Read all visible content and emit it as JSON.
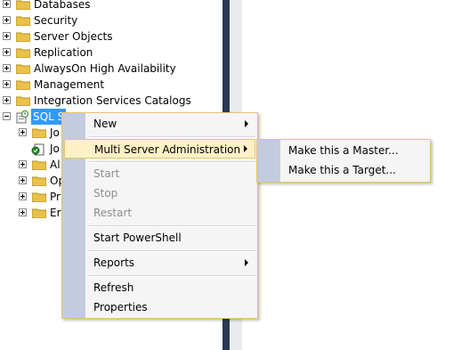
{
  "tree": {
    "items": [
      {
        "label": "Databases",
        "expander": "plus"
      },
      {
        "label": "Security",
        "expander": "plus"
      },
      {
        "label": "Server Objects",
        "expander": "plus"
      },
      {
        "label": "Replication",
        "expander": "plus"
      },
      {
        "label": "AlwaysOn High Availability",
        "expander": "plus"
      },
      {
        "label": "Management",
        "expander": "plus"
      },
      {
        "label": "Integration Services Catalogs",
        "expander": "plus"
      }
    ],
    "agent": {
      "label": "SQL S",
      "expander": "minus"
    },
    "children": [
      {
        "label": "Jo",
        "icon": "folder-icon",
        "expander": "plus"
      },
      {
        "label": "Jo",
        "icon": "job-activity-icon",
        "expander": ""
      },
      {
        "label": "Al",
        "icon": "folder-icon",
        "expander": "plus"
      },
      {
        "label": "Op",
        "icon": "folder-icon",
        "expander": "plus"
      },
      {
        "label": "Pr",
        "icon": "folder-icon",
        "expander": "plus"
      },
      {
        "label": "Err",
        "icon": "folder-icon",
        "expander": "plus"
      }
    ]
  },
  "context_menu": {
    "new": "New",
    "multi_server": "Multi Server Administration",
    "start": "Start",
    "stop": "Stop",
    "restart": "Restart",
    "start_powershell": "Start PowerShell",
    "reports": "Reports",
    "refresh": "Refresh",
    "properties": "Properties"
  },
  "submenu": {
    "make_master": "Make this a Master...",
    "make_target": "Make this a Target..."
  },
  "colors": {
    "folder": "#e8c24a",
    "selection": "#3399ff",
    "menu_gutter": "#c2cbe0",
    "menu_highlight": "#fff1c4",
    "splitter": "#293955"
  }
}
